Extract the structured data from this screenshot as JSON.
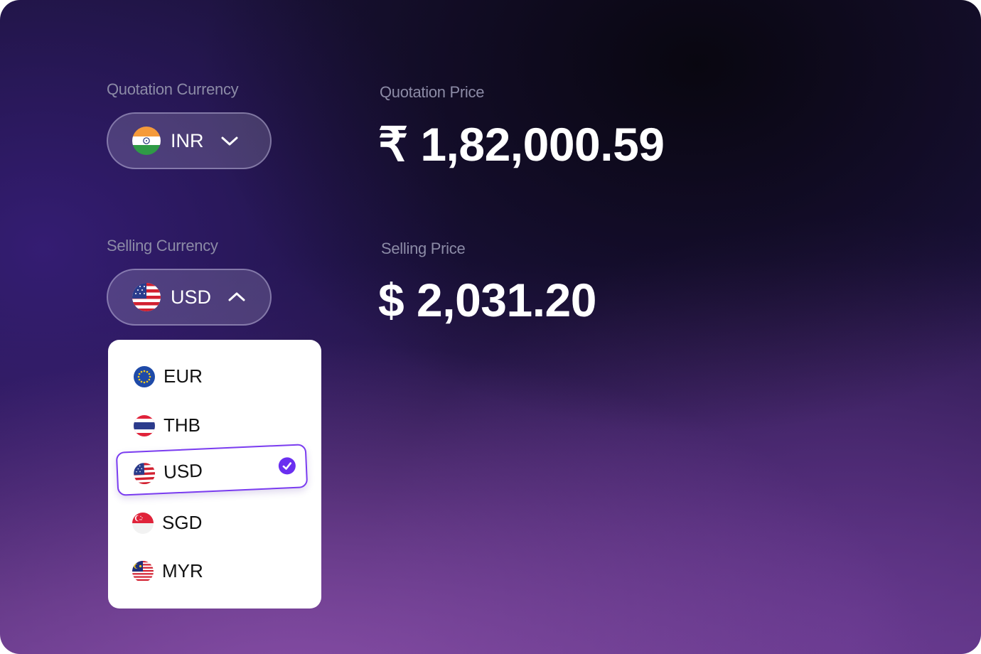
{
  "quotation": {
    "currency_label": "Quotation Currency",
    "currency_code": "INR",
    "currency_flag": "india-flag",
    "price_label": "Quotation Price",
    "price_value": "₹ 1,82,000.59"
  },
  "selling": {
    "currency_label": "Selling Currency",
    "currency_code": "USD",
    "currency_flag": "usa-flag",
    "price_label": "Selling Price",
    "price_value": "$ 2,031.20"
  },
  "dropdown": {
    "options": [
      {
        "code": "EUR",
        "flag": "eu-flag"
      },
      {
        "code": "THB",
        "flag": "thailand-flag"
      },
      {
        "code": "USD",
        "flag": "usa-flag",
        "selected": true
      },
      {
        "code": "SGD",
        "flag": "singapore-flag"
      },
      {
        "code": "MYR",
        "flag": "malaysia-flag"
      }
    ]
  },
  "colors": {
    "accent": "#6a2ff0",
    "label_text": "#8c8ba6",
    "price_text": "#ffffff"
  }
}
